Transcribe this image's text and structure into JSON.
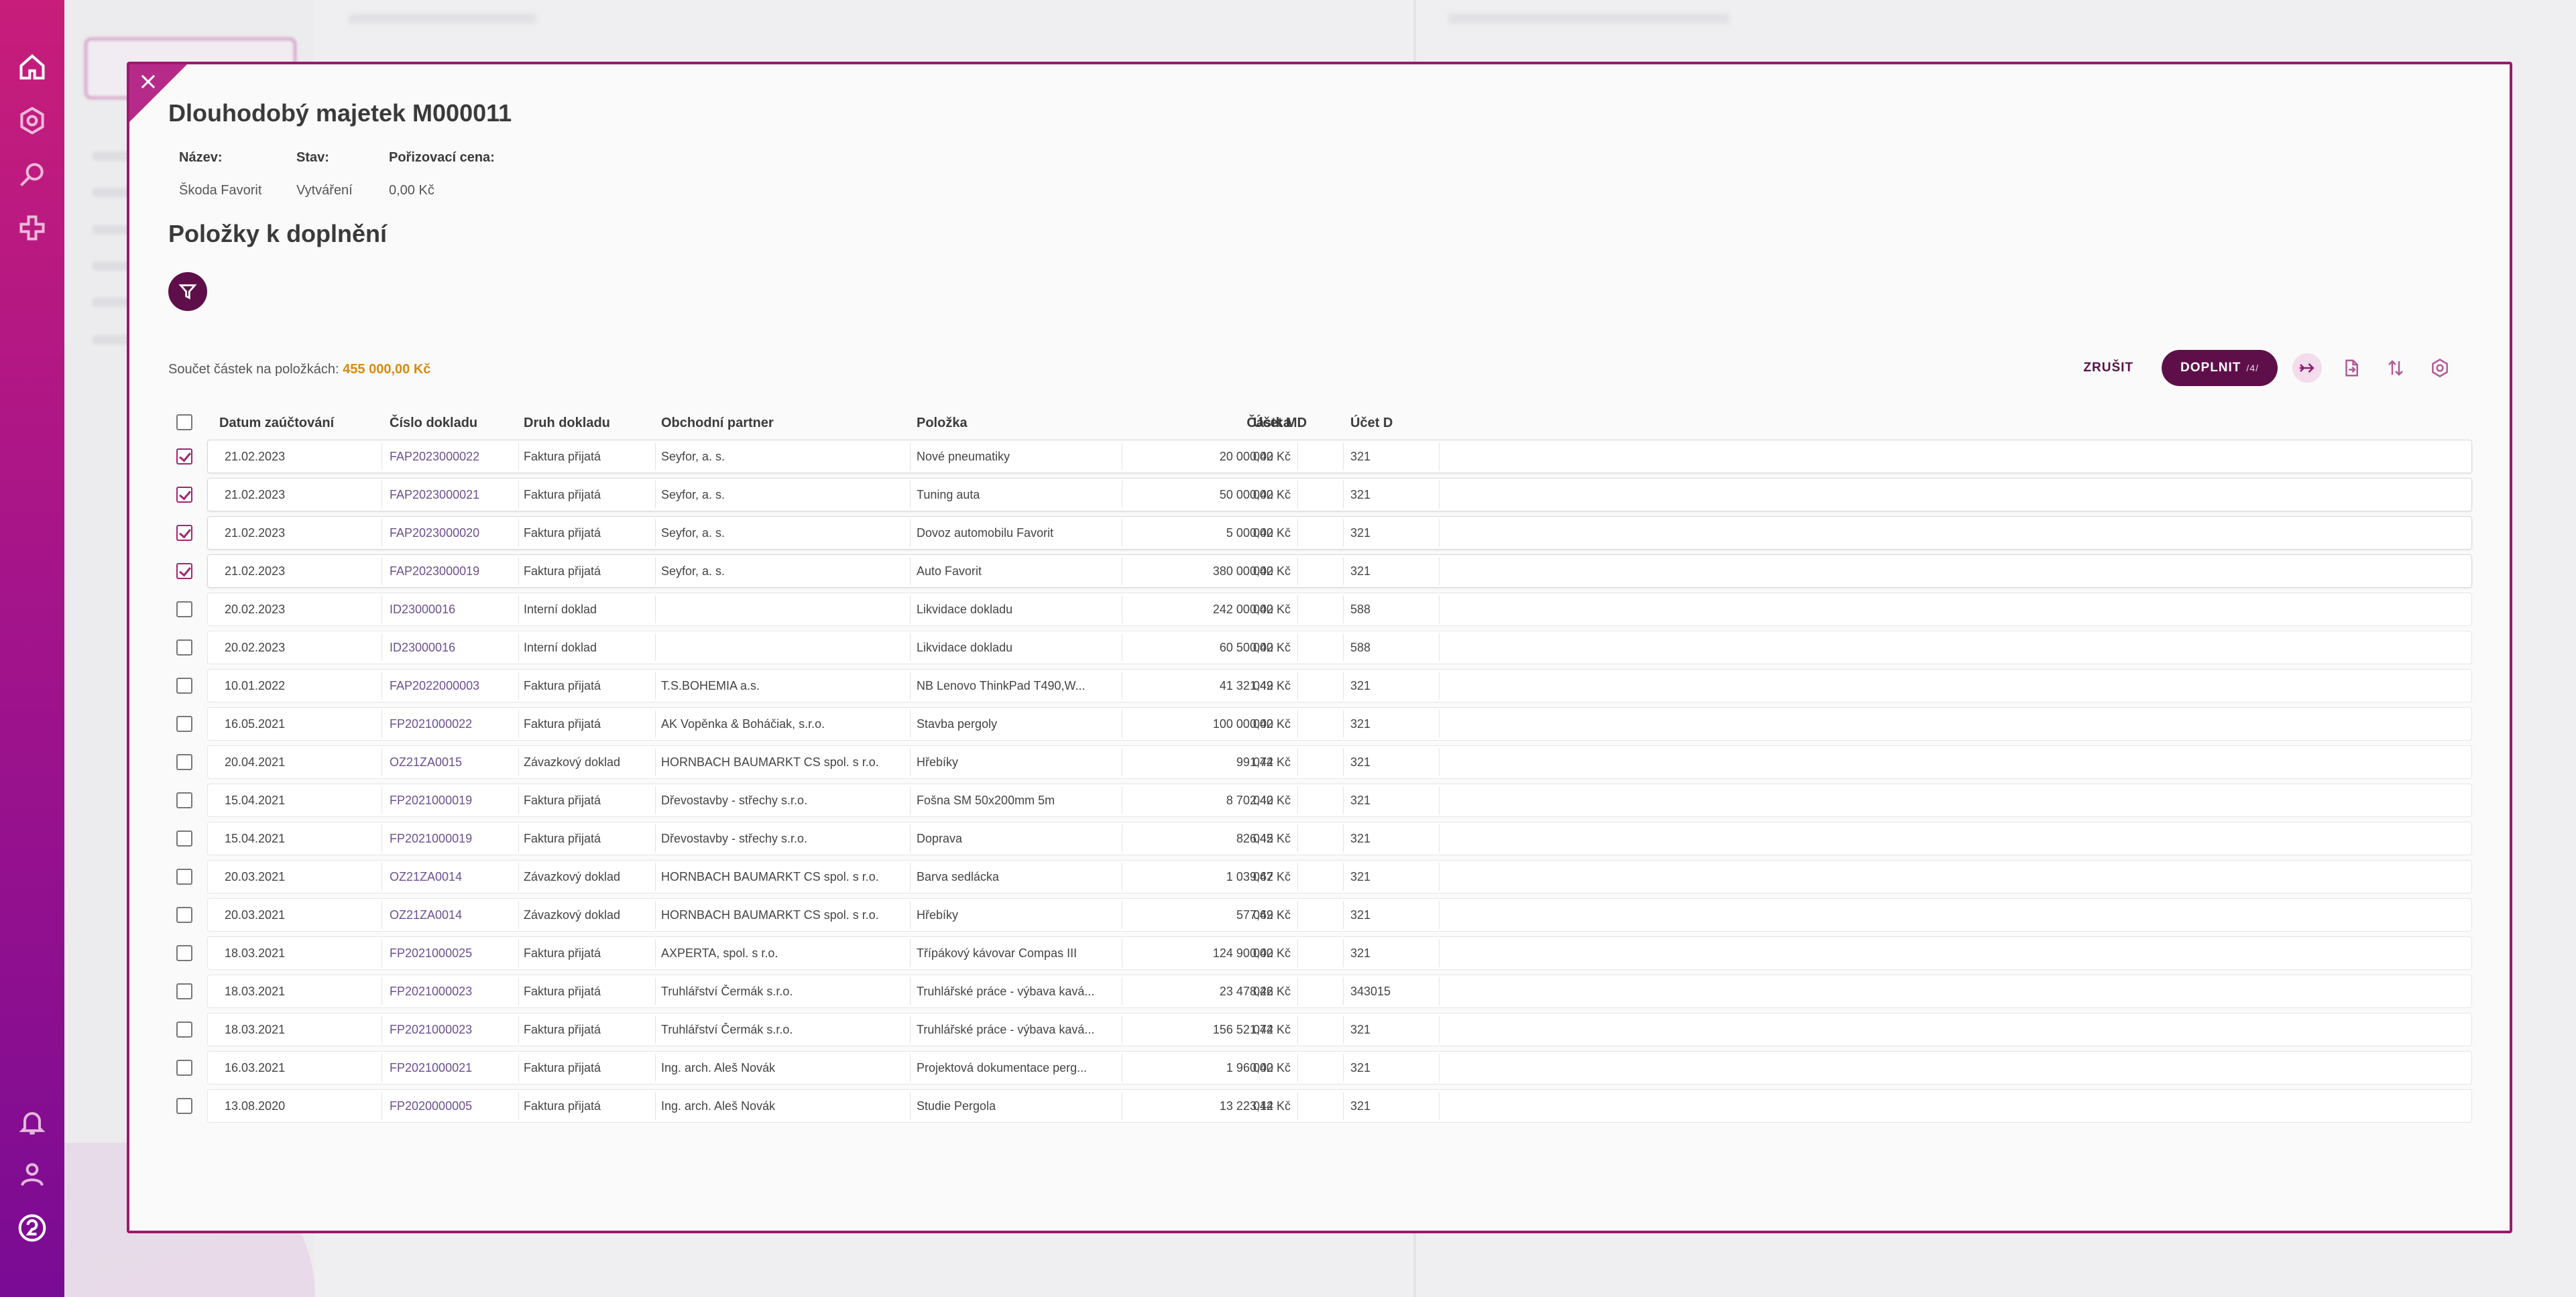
{
  "modal": {
    "close_symbol": "×",
    "title": "Dlouhodobý majetek M000011",
    "meta": [
      {
        "label": "Název:",
        "value": "Škoda Favorit"
      },
      {
        "label": "Stav:",
        "value": "Vytváření"
      },
      {
        "label": "Pořizovací cena:",
        "value": "0,00 Kč"
      }
    ],
    "subtitle": "Položky k doplnění",
    "sum_label": "Součet částek na položkách:",
    "sum_value": "455 000,00 Kč",
    "toolbar": {
      "cancel_label": "ZRUŠIT",
      "submit_label": "DOPLNIT",
      "submit_count": "/4/"
    }
  },
  "table": {
    "columns": [
      "Datum zaúčtování",
      "Číslo dokladu",
      "Druh dokladu",
      "Obchodní partner",
      "Položka",
      "Částka",
      "Účet MD",
      "Účet D"
    ],
    "rows": [
      {
        "checked": true,
        "date": "21.02.2023",
        "doc": "FAP2023000022",
        "type": "Faktura přijatá",
        "partner": "Seyfor, a. s.",
        "item": "Nové pneumatiky",
        "amount": "20 000,00 Kč",
        "md": "042",
        "d": "321"
      },
      {
        "checked": true,
        "date": "21.02.2023",
        "doc": "FAP2023000021",
        "type": "Faktura přijatá",
        "partner": "Seyfor, a. s.",
        "item": "Tuning auta",
        "amount": "50 000,00 Kč",
        "md": "042",
        "d": "321"
      },
      {
        "checked": true,
        "date": "21.02.2023",
        "doc": "FAP2023000020",
        "type": "Faktura přijatá",
        "partner": "Seyfor, a. s.",
        "item": "Dovoz automobilu Favorit",
        "amount": "5 000,00 Kč",
        "md": "042",
        "d": "321"
      },
      {
        "checked": true,
        "date": "21.02.2023",
        "doc": "FAP2023000019",
        "type": "Faktura přijatá",
        "partner": "Seyfor, a. s.",
        "item": "Auto Favorit",
        "amount": "380 000,00 Kč",
        "md": "042",
        "d": "321"
      },
      {
        "checked": false,
        "date": "20.02.2023",
        "doc": "ID23000016",
        "type": "Interní doklad",
        "partner": "",
        "item": "Likvidace dokladu",
        "amount": "242 000,00 Kč",
        "md": "042",
        "d": "588"
      },
      {
        "checked": false,
        "date": "20.02.2023",
        "doc": "ID23000016",
        "type": "Interní doklad",
        "partner": "",
        "item": "Likvidace dokladu",
        "amount": "60 500,00 Kč",
        "md": "042",
        "d": "588"
      },
      {
        "checked": false,
        "date": "10.01.2022",
        "doc": "FAP2022000003",
        "type": "Faktura přijatá",
        "partner": "T.S.BOHEMIA a.s.",
        "item": "NB Lenovo ThinkPad T490,W...",
        "amount": "41 321,49 Kč",
        "md": "042",
        "d": "321"
      },
      {
        "checked": false,
        "date": "16.05.2021",
        "doc": "FP2021000022",
        "type": "Faktura přijatá",
        "partner": "AK Vopěnka & Boháčiak, s.r.o.",
        "item": "Stavba pergoly",
        "amount": "100 000,00 Kč",
        "md": "042",
        "d": "321"
      },
      {
        "checked": false,
        "date": "20.04.2021",
        "doc": "OZ21ZA0015",
        "type": "Závazkový doklad",
        "partner": "HORNBACH BAUMARKT CS spol. s r.o.",
        "item": "Hřebíky",
        "amount": "991,74 Kč",
        "md": "042",
        "d": "321"
      },
      {
        "checked": false,
        "date": "15.04.2021",
        "doc": "FP2021000019",
        "type": "Faktura přijatá",
        "partner": "Dřevostavby - střechy s.r.o.",
        "item": "Fošna SM 50x200mm 5m",
        "amount": "8 702,40 Kč",
        "md": "042",
        "d": "321"
      },
      {
        "checked": false,
        "date": "15.04.2021",
        "doc": "FP2021000019",
        "type": "Faktura přijatá",
        "partner": "Dřevostavby - střechy s.r.o.",
        "item": "Doprava",
        "amount": "826,45 Kč",
        "md": "042",
        "d": "321"
      },
      {
        "checked": false,
        "date": "20.03.2021",
        "doc": "OZ21ZA0014",
        "type": "Závazkový doklad",
        "partner": "HORNBACH BAUMARKT CS spol. s r.o.",
        "item": "Barva sedlácka",
        "amount": "1 039,67 Kč",
        "md": "042",
        "d": "321"
      },
      {
        "checked": false,
        "date": "20.03.2021",
        "doc": "OZ21ZA0014",
        "type": "Závazkový doklad",
        "partner": "HORNBACH BAUMARKT CS spol. s r.o.",
        "item": "Hřebíky",
        "amount": "577,69 Kč",
        "md": "042",
        "d": "321"
      },
      {
        "checked": false,
        "date": "18.03.2021",
        "doc": "FP2021000025",
        "type": "Faktura přijatá",
        "partner": "AXPERTA, spol. s r.o.",
        "item": "Třípákový kávovar Compas III",
        "amount": "124 900,00 Kč",
        "md": "042",
        "d": "321"
      },
      {
        "checked": false,
        "date": "18.03.2021",
        "doc": "FP2021000023",
        "type": "Faktura přijatá",
        "partner": "Truhlářství Čermák s.r.o.",
        "item": "Truhlářské práce - výbava kavá...",
        "amount": "23 478,26 Kč",
        "md": "042",
        "d": "343015"
      },
      {
        "checked": false,
        "date": "18.03.2021",
        "doc": "FP2021000023",
        "type": "Faktura přijatá",
        "partner": "Truhlářství Čermák s.r.o.",
        "item": "Truhlářské práce - výbava kavá...",
        "amount": "156 521,74 Kč",
        "md": "042",
        "d": "321"
      },
      {
        "checked": false,
        "date": "16.03.2021",
        "doc": "FP2021000021",
        "type": "Faktura přijatá",
        "partner": "Ing. arch. Aleš Novák",
        "item": "Projektová dokumentace perg...",
        "amount": "1 960,00 Kč",
        "md": "042",
        "d": "321"
      },
      {
        "checked": false,
        "date": "13.08.2020",
        "doc": "FP2020000005",
        "type": "Faktura přijatá",
        "partner": "Ing. arch. Aleš Novák",
        "item": "Studie Pergola",
        "amount": "13 223,14 Kč",
        "md": "042",
        "d": "321"
      }
    ]
  },
  "icons": {
    "rail_top": [
      "home-icon",
      "settings-icon",
      "search-icon",
      "plus-icon"
    ],
    "rail_bottom": [
      "bell-icon",
      "user-icon",
      "help-icon"
    ],
    "toolbar": [
      "link-arrow-icon",
      "document-icon",
      "sort-icon",
      "settings-icon"
    ]
  },
  "colors": {
    "accent": "#5e0f4a",
    "sum_amount": "#d98a10",
    "link": "#6c4f8f",
    "modal_border": "#9a1a6d"
  }
}
